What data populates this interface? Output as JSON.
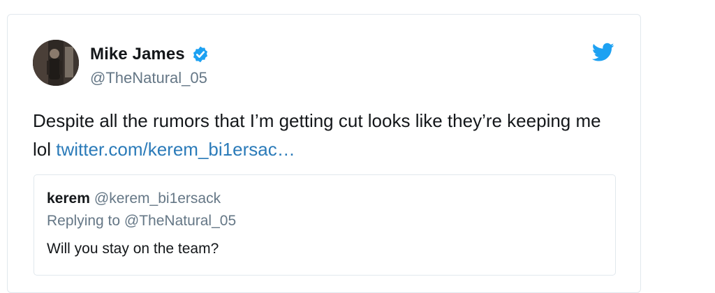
{
  "tweet": {
    "author": {
      "display_name": "Mike James",
      "handle": "@TheNatural_05",
      "verified": true,
      "avatar_icon": "user-avatar"
    },
    "text": "Despite all the rumors that I’m getting cut looks like they’re keeping me lol",
    "link_text": "twitter.com/kerem_bi1ersac…",
    "brand_icon": "twitter-bird-icon",
    "quoted": {
      "author_name": "kerem",
      "author_handle": "@kerem_bi1ersack",
      "replying_to": "Replying to @TheNatural_05",
      "text": "Will you stay on the team?"
    }
  },
  "colors": {
    "text_primary": "#14171a",
    "text_secondary": "#657786",
    "link": "#2b7bb9",
    "twitter_blue": "#1da1f2",
    "border": "#e1e8ed"
  }
}
